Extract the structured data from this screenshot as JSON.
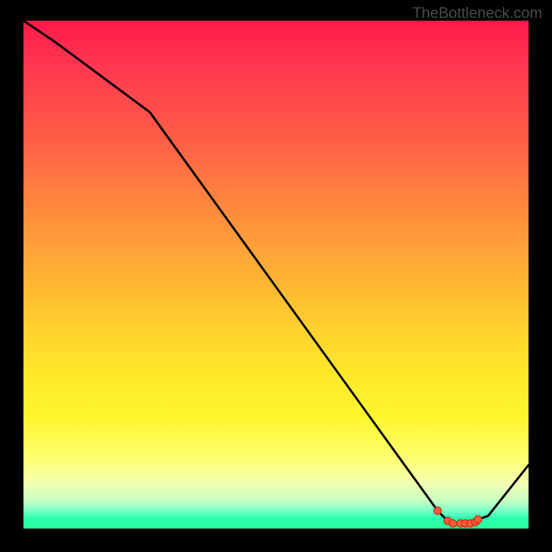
{
  "watermark": "TheBottleneck.com",
  "chart_data": {
    "type": "line",
    "title": "",
    "xlabel": "",
    "ylabel": "",
    "x": [
      0.0,
      0.06,
      0.25,
      0.82,
      0.84,
      0.85,
      0.865,
      0.875,
      0.885,
      0.895,
      0.9,
      0.92,
      1.0
    ],
    "values": [
      1.0,
      0.96,
      0.82,
      0.035,
      0.015,
      0.01,
      0.01,
      0.01,
      0.01,
      0.013,
      0.018,
      0.025,
      0.125
    ],
    "xlim": [
      0,
      1
    ],
    "ylim": [
      0,
      1
    ],
    "marker_indices": [
      3,
      4,
      5,
      6,
      7,
      8,
      9,
      10
    ],
    "background": "heat-gradient (red→yellow→green vertical)",
    "note": "x and y are normalized to plot area; original axes not labeled in image"
  }
}
